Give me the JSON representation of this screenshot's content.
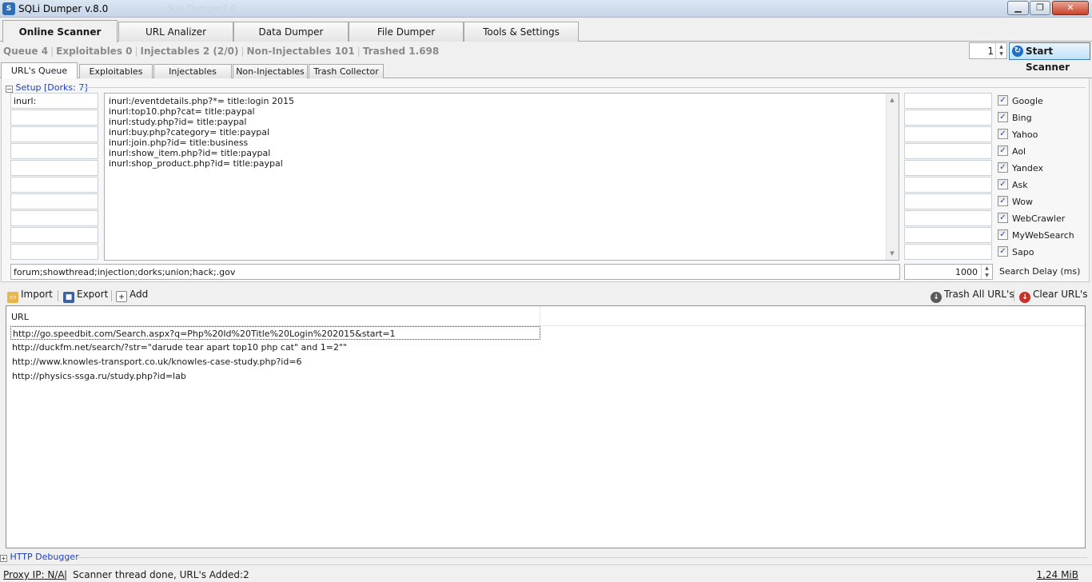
{
  "window": {
    "title": "SQLi Dumper v.8.0",
    "icon_name": "app-icon",
    "ghost_title": "Sqli Dumper7.0",
    "minimize_label": "▁",
    "maximize_label": "❐",
    "close_label": "✕"
  },
  "main_tabs": [
    {
      "label": "Online Scanner",
      "active": true
    },
    {
      "label": "URL Analizer",
      "active": false
    },
    {
      "label": "Data Dumper",
      "active": false
    },
    {
      "label": "File Dumper",
      "active": false
    },
    {
      "label": "Tools & Settings",
      "active": false
    }
  ],
  "stats": {
    "queue": "Queue 4",
    "exploitables": "Exploitables 0",
    "injectables": "Injectables 2 (2/0)",
    "non_injectables": "Non-Injectables 101",
    "trashed": "Trashed 1.698"
  },
  "scanner": {
    "threads_value": "1",
    "start_label": "Start Scanner",
    "start_icon": "refresh-icon"
  },
  "sub_tabs": [
    {
      "label": "URL's Queue",
      "active": true
    },
    {
      "label": "Exploitables",
      "active": false
    },
    {
      "label": "Injectables",
      "active": false
    },
    {
      "label": "Non-Injectables",
      "active": false
    },
    {
      "label": "Trash Collector",
      "active": false
    }
  ],
  "setup": {
    "header": "Setup [Dorks: 7]",
    "toggle": "−",
    "prefix_first": "inurl:",
    "dorks": [
      "inurl:/eventdetails.php?*= title:login 2015",
      "inurl:top10.php?cat= title:paypal",
      "inurl:study.php?id= title:paypal",
      "inurl:buy.php?category= title:paypal",
      "inurl:join.php?id= title:business",
      "inurl:show_item.php?id= title:paypal",
      "inurl:shop_product.php?id= title:paypal"
    ],
    "keywords": "forum;showthread;injection;dorks;union;hack;.gov",
    "search_delay_value": "1000",
    "search_delay_label": "Search Delay (ms)",
    "check_mark": "✓"
  },
  "engines": [
    {
      "label": "Google",
      "checked": true
    },
    {
      "label": "Bing",
      "checked": true
    },
    {
      "label": "Yahoo",
      "checked": true
    },
    {
      "label": "Aol",
      "checked": true
    },
    {
      "label": "Yandex",
      "checked": true
    },
    {
      "label": "Ask",
      "checked": true
    },
    {
      "label": "Wow",
      "checked": true
    },
    {
      "label": "WebCrawler",
      "checked": true
    },
    {
      "label": "MyWebSearch",
      "checked": true
    },
    {
      "label": "Sapo",
      "checked": true
    }
  ],
  "toolbar": {
    "import_label": "Import",
    "export_label": "Export",
    "add_label": "Add",
    "trash_all_label": "Trash All URL's",
    "clear_label": "Clear URL's"
  },
  "url_list": {
    "column": "URL",
    "rows": [
      "http://go.speedbit.com/Search.aspx?q=Php%20Id%20Title%20Login%202015&start=1",
      "http://duckfm.net/search/?str=\"darude tear apart top10 php cat\" and 1=2\"\"",
      "http://www.knowles-transport.co.uk/knowles-case-study.php?id=6",
      "http://physics-ssga.ru/study.php?id=lab"
    ]
  },
  "bottom": {
    "debugger_label": "HTTP Debugger",
    "debugger_toggle": "+",
    "proxy": "Proxy IP: N/A",
    "separator": "|",
    "status": "Scanner thread done, URL's Added:2",
    "memory": "1,24 MiB"
  }
}
